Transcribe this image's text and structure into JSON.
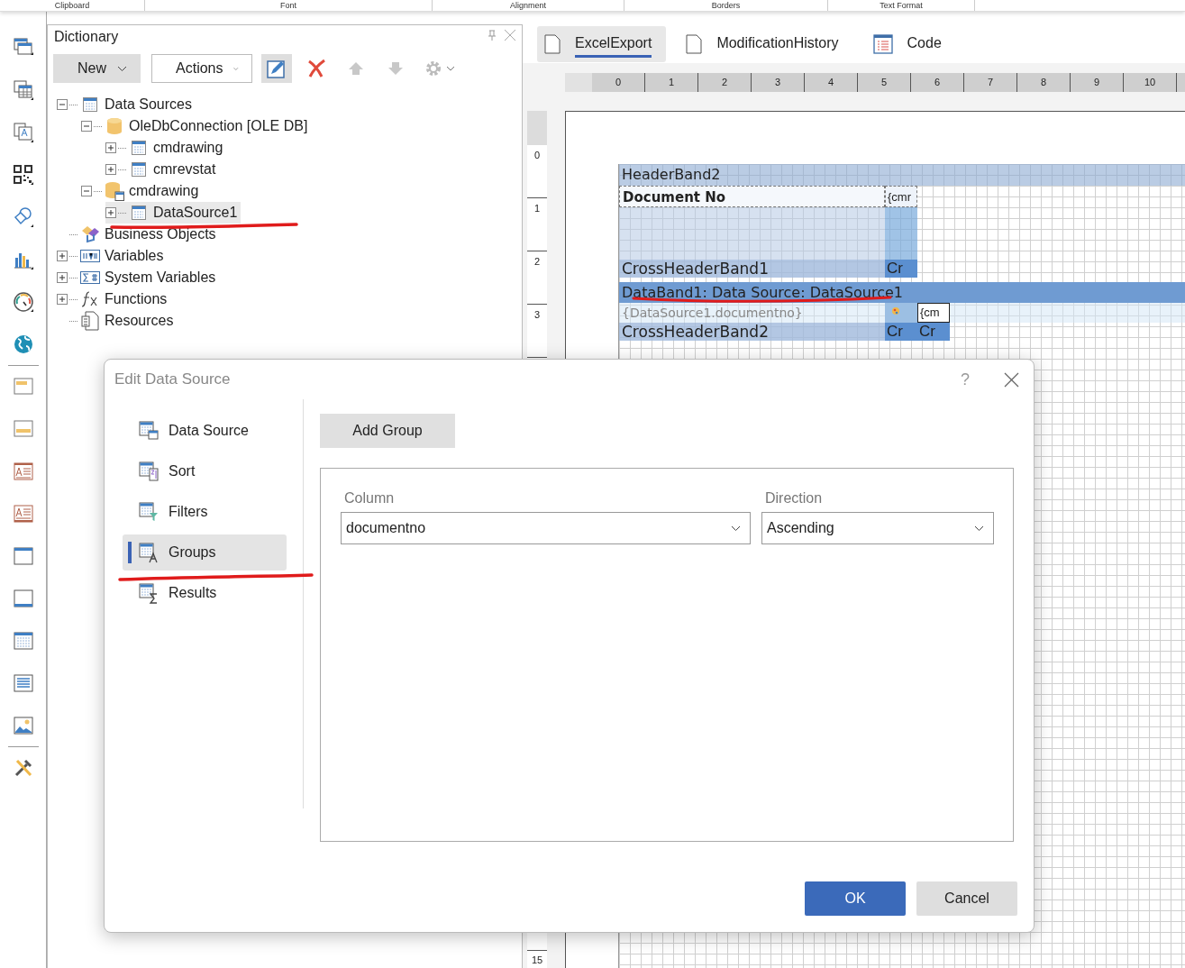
{
  "ribbon_groups": [
    "Clipboard",
    "Font",
    "Alignment",
    "Borders",
    "Text Format"
  ],
  "dictionary": {
    "title": "Dictionary",
    "new_button": "New",
    "actions_button": "Actions",
    "tree": [
      {
        "label": "Data Sources",
        "kind": "table",
        "expanded": true,
        "selected": false,
        "children": [
          {
            "label": "OleDbConnection [OLE DB]",
            "kind": "database",
            "expanded": true,
            "selected": false,
            "children": [
              {
                "label": "cmdrawing",
                "kind": "table",
                "expanded": false,
                "selected": false
              },
              {
                "label": "cmrevstat",
                "kind": "table",
                "expanded": false,
                "selected": false
              }
            ]
          },
          {
            "label": "cmdrawing",
            "kind": "database-view",
            "expanded": true,
            "selected": false,
            "children": [
              {
                "label": "DataSource1",
                "kind": "table",
                "expanded": false,
                "selected": true
              }
            ]
          }
        ]
      },
      {
        "label": "Business Objects",
        "kind": "business",
        "selected": false
      },
      {
        "label": "Variables",
        "kind": "variables",
        "expanded": false,
        "selected": false
      },
      {
        "label": "System Variables",
        "kind": "sysvars",
        "expanded": false,
        "selected": false
      },
      {
        "label": "Functions",
        "kind": "functions",
        "expanded": false,
        "selected": false
      },
      {
        "label": "Resources",
        "kind": "resources",
        "selected": false
      }
    ]
  },
  "report": {
    "tabs": [
      {
        "label": "ExcelExport",
        "kind": "page",
        "selected": true
      },
      {
        "label": "ModificationHistory",
        "kind": "page",
        "selected": false
      },
      {
        "label": "Code",
        "kind": "code",
        "selected": false
      }
    ],
    "ruler": [
      "0",
      "1",
      "2",
      "3",
      "4",
      "5",
      "6",
      "7",
      "8",
      "9",
      "10"
    ],
    "vertical_ruler": [
      "0",
      "1",
      "2",
      "3",
      "15"
    ],
    "header_band": {
      "title": "HeaderBand2",
      "cells": [
        "Document No",
        "{cmr"
      ]
    },
    "cross_header_1": {
      "title": "CrossHeaderBand1",
      "cells": [
        "Cr"
      ]
    },
    "data_band": {
      "title": "DataBand1: Data Source: DataSource1",
      "cells": [
        "{DataSource1.documentno}",
        "{cm"
      ]
    },
    "cross_header_2": {
      "title": "CrossHeaderBand2",
      "cells": [
        "Cr",
        "Cr"
      ]
    }
  },
  "dialog": {
    "title": "Edit Data Source",
    "help": "?",
    "nav": [
      {
        "label": "Data Source",
        "kind": "source",
        "selected": false
      },
      {
        "label": "Sort",
        "kind": "sort",
        "selected": false
      },
      {
        "label": "Filters",
        "kind": "filter",
        "selected": false
      },
      {
        "label": "Groups",
        "kind": "group",
        "selected": true
      },
      {
        "label": "Results",
        "kind": "results",
        "selected": false
      }
    ],
    "add_group_button": "Add Group",
    "group": {
      "column_label": "Column",
      "column_value": "documentno",
      "direction_label": "Direction",
      "direction_value": "Ascending"
    },
    "buttons": [
      {
        "label": "OK",
        "kind": "primary"
      },
      {
        "label": "Cancel",
        "kind": "secondary"
      }
    ]
  }
}
